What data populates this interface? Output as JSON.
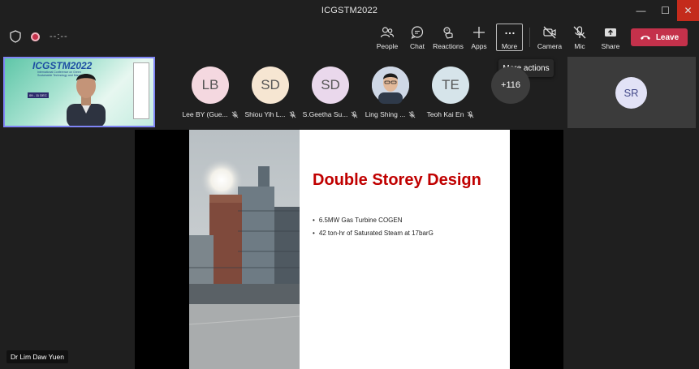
{
  "window": {
    "title": "ICGSTM2022",
    "minimize_glyph": "—",
    "maximize_glyph": "☐",
    "close_glyph": "✕"
  },
  "toolbar": {
    "timer": "--:--",
    "buttons": {
      "people": "People",
      "chat": "Chat",
      "reactions": "Reactions",
      "apps": "Apps",
      "more": "More",
      "camera": "Camera",
      "mic": "Mic",
      "share": "Share"
    },
    "leave_label": "Leave",
    "tooltip": "More actions"
  },
  "participants": [
    {
      "initials": "LB",
      "name": "Lee BY (Gue...",
      "color": "#f4d8e0"
    },
    {
      "initials": "SD",
      "name": "Shiou Yih L...",
      "color": "#f6e6d2"
    },
    {
      "initials": "SD",
      "name": "S.Geetha Su...",
      "color": "#ead8ec"
    },
    {
      "initials": "",
      "name": "Ling Shing ...",
      "color": "#cfd8e6"
    },
    {
      "initials": "TE",
      "name": "Teoh Kai En",
      "color": "#d6e4ea"
    }
  ],
  "overflow_count": "+116",
  "side_tile": {
    "initials": "SR"
  },
  "self_view": {
    "banner_title": "ICGSTM2022",
    "banner_sub": "International Conference on Green Sustainable Technology and Management",
    "banner_date": "09 - 11 DEC"
  },
  "slide": {
    "title": "Double Storey Design",
    "bullets": [
      "6.5MW Gas Turbine COGEN",
      "42 ton-hr of Saturated Steam at 17barG"
    ],
    "bullet_glyph": "•"
  },
  "speaker_name": "Dr Lim Daw Yuen",
  "colors": {
    "leave": "#c4314b",
    "selection": "#7f85f5",
    "slide_title": "#c00000"
  }
}
